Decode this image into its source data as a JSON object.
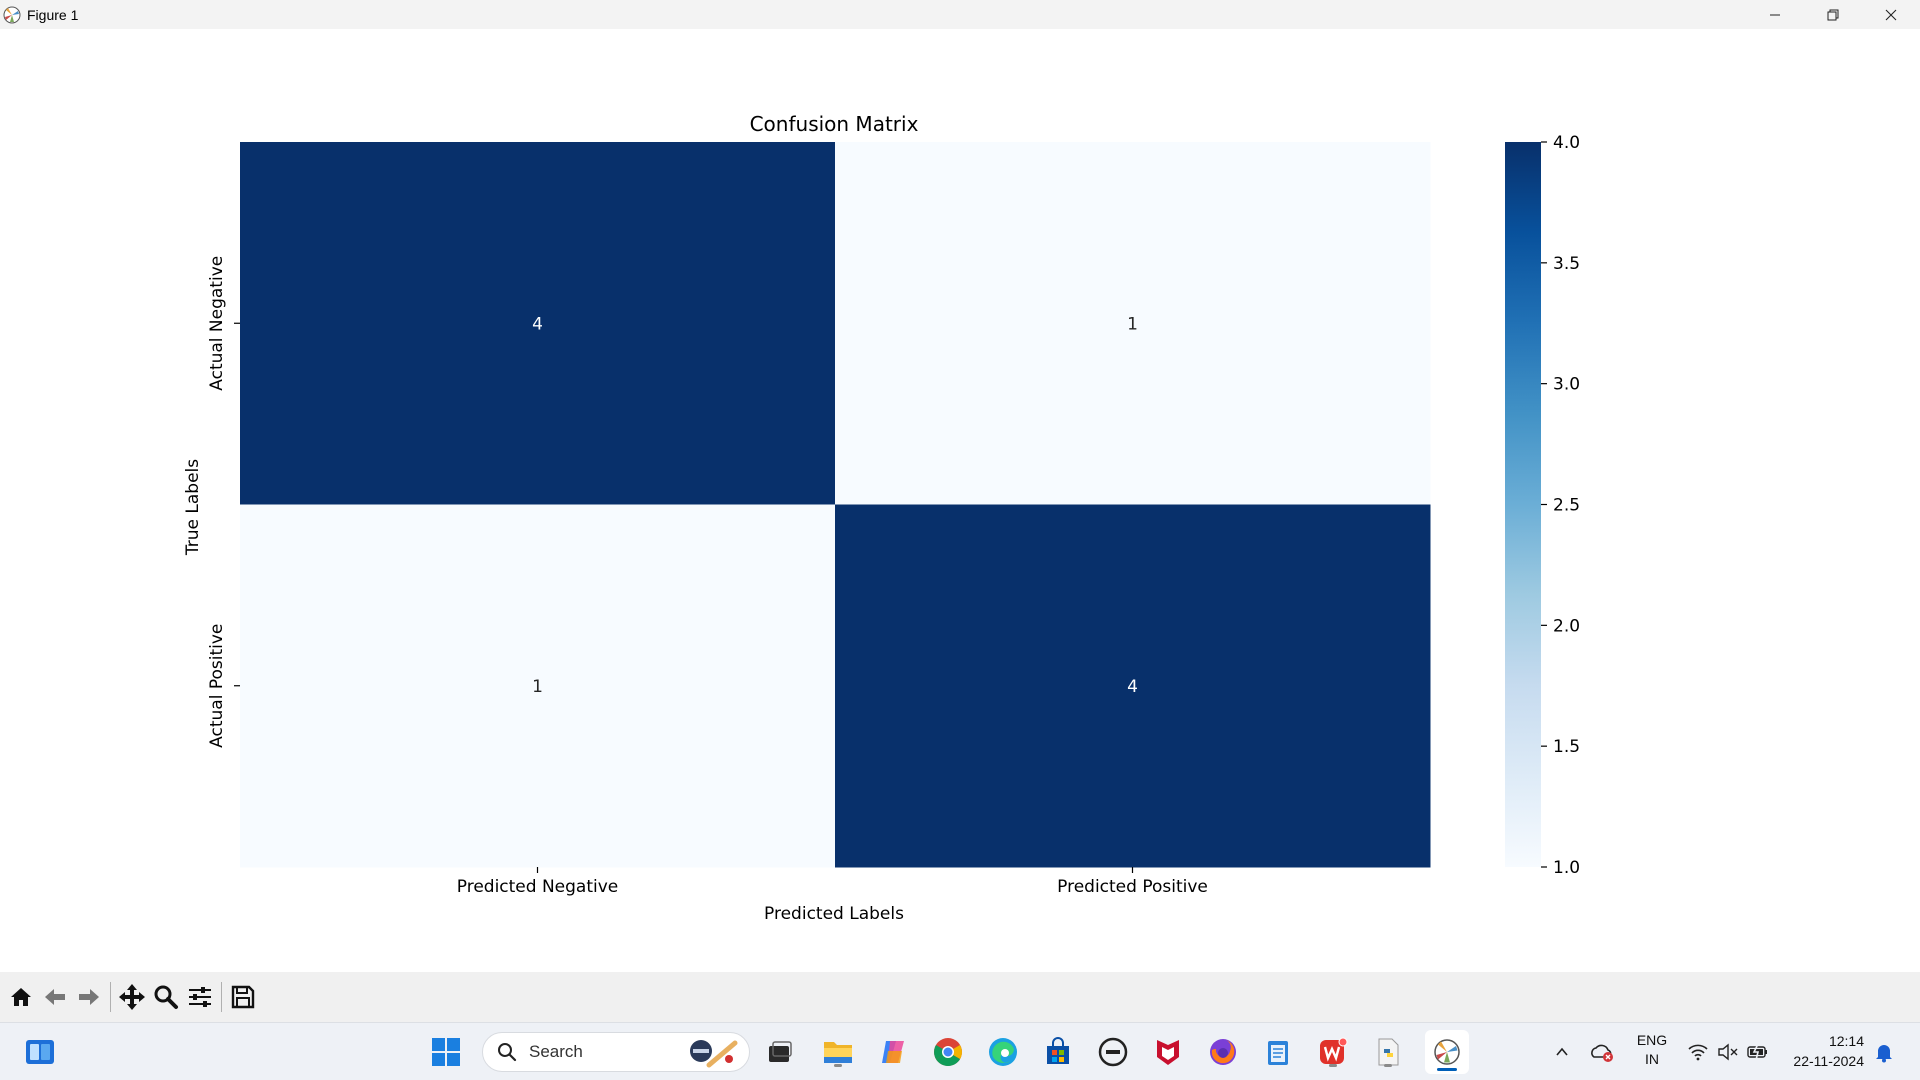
{
  "window": {
    "title": "Figure 1",
    "controls": [
      "minimize-icon",
      "restore-icon",
      "close-icon"
    ]
  },
  "chart_data": {
    "type": "heatmap",
    "title": "Confusion Matrix",
    "xlabel": "Predicted Labels",
    "ylabel": "True Labels",
    "x_categories": [
      "Predicted Negative",
      "Predicted Positive"
    ],
    "y_categories": [
      "Actual Negative",
      "Actual Positive"
    ],
    "values": [
      [
        4,
        1
      ],
      [
        1,
        4
      ]
    ],
    "colormap": "Blues",
    "colorbar": {
      "min": 1.0,
      "max": 4.0,
      "ticks": [
        "1.0",
        "1.5",
        "2.0",
        "2.5",
        "3.0",
        "3.5",
        "4.0"
      ],
      "low_color": "#f7fbff",
      "high_color": "#08306b"
    },
    "grid": false
  },
  "toolbar": {
    "items": [
      "home-icon",
      "back-arrow-icon",
      "forward-arrow-icon",
      "pan-icon",
      "zoom-icon",
      "configure-subplots-icon",
      "save-icon"
    ]
  },
  "taskbar": {
    "search_placeholder": "Search",
    "tray_lang_line1": "ENG",
    "tray_lang_line2": "IN",
    "time": "12:14",
    "date": "22-11-2024"
  }
}
